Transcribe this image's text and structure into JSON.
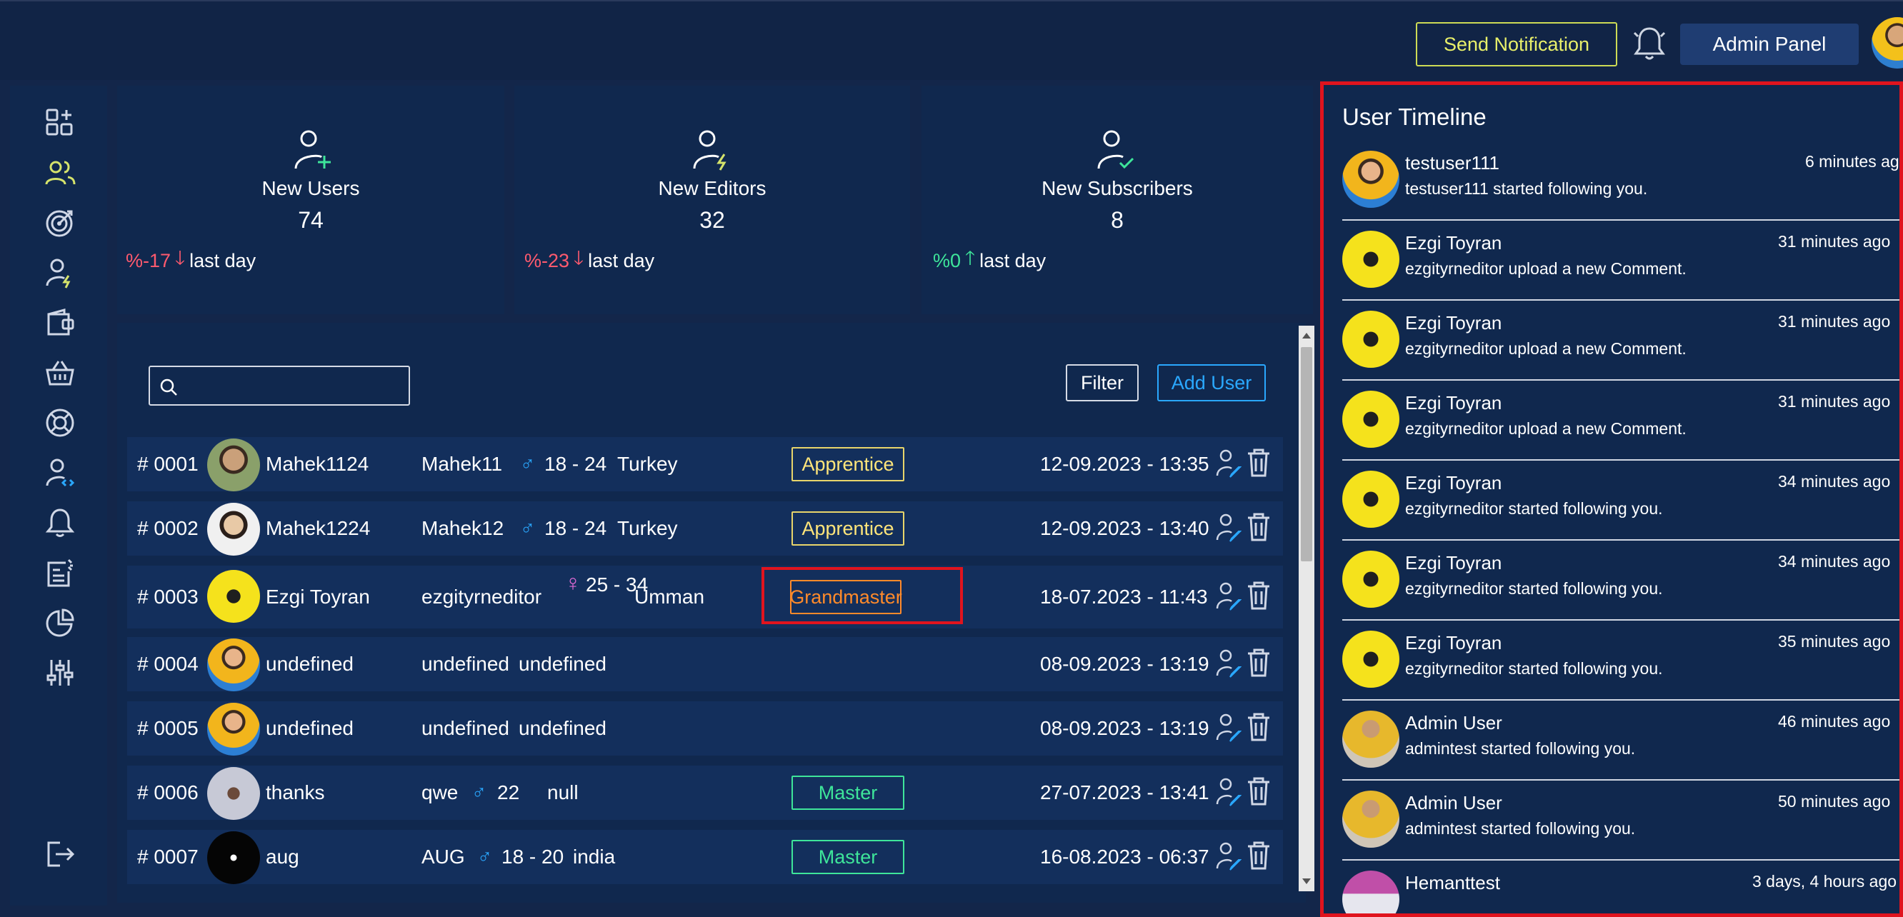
{
  "topbar": {
    "send_notification_label": "Send Notification",
    "admin_panel_label": "Admin Panel"
  },
  "sidebar": {
    "items": [
      "dashboard-icon",
      "users-icon",
      "target-icon",
      "editor-user-icon",
      "wallet-icon",
      "basket-icon",
      "lifebuoy-icon",
      "developer-user-icon",
      "bell-icon",
      "report-icon",
      "pie-chart-icon",
      "sliders-icon"
    ],
    "logout": "logout-icon"
  },
  "stats": [
    {
      "title": "New Users",
      "value": "74",
      "change": "%-17",
      "period": "last day",
      "trend": "down"
    },
    {
      "title": "New Editors",
      "value": "32",
      "change": "%-23",
      "period": "last day",
      "trend": "down"
    },
    {
      "title": "New Subscribers",
      "value": "8",
      "change": "%0",
      "period": "last day",
      "trend": "up"
    }
  ],
  "table": {
    "search_placeholder": "",
    "filter_label": "Filter",
    "add_user_label": "Add User",
    "rows": [
      {
        "id": "# 0001",
        "name": "Mahek1124",
        "username": "Mahek11",
        "gender": "♂",
        "age": "18 - 24",
        "country": "Turkey",
        "badge": "Apprentice",
        "date": "12-09.2023 - 13:35"
      },
      {
        "id": "# 0002",
        "name": "Mahek1224",
        "username": "Mahek12",
        "gender": "♂",
        "age": "18 - 24",
        "country": "Turkey",
        "badge": "Apprentice",
        "date": "12-09.2023 - 13:40"
      },
      {
        "id": "# 0003",
        "name": "Ezgi Toyran",
        "username": "ezgityrneditor",
        "gender": "♀",
        "age": "25 - 34",
        "country": "Umman",
        "badge": "Grandmaster",
        "date": "18-07.2023 - 11:43"
      },
      {
        "id": "# 0004",
        "name": "undefined",
        "username": "undefined",
        "gender": "",
        "age": "",
        "country": "undefined",
        "badge": "",
        "date": "08-09.2023 - 13:19"
      },
      {
        "id": "# 0005",
        "name": "undefined",
        "username": "undefined",
        "gender": "",
        "age": "",
        "country": "undefined",
        "badge": "",
        "date": "08-09.2023 - 13:19"
      },
      {
        "id": "# 0006",
        "name": "thanks",
        "username": "qwe",
        "gender": "♂",
        "age": "22",
        "country": "null",
        "badge": "Master",
        "date": "27-07.2023 - 13:41"
      },
      {
        "id": "# 0007",
        "name": "aug",
        "username": "AUG",
        "gender": "♂",
        "age": "18 - 20",
        "country": "india",
        "badge": "Master",
        "date": "16-08.2023 - 06:37"
      }
    ]
  },
  "timeline": {
    "title": "User Timeline",
    "items": [
      {
        "name": "testuser111",
        "text": "testuser111 started following you.",
        "time": "6 minutes ago"
      },
      {
        "name": "Ezgi Toyran",
        "text": "ezgityrneditor upload a new Comment.",
        "time": "31 minutes ago"
      },
      {
        "name": "Ezgi Toyran",
        "text": "ezgityrneditor upload a new Comment.",
        "time": "31 minutes ago"
      },
      {
        "name": "Ezgi Toyran",
        "text": "ezgityrneditor upload a new Comment.",
        "time": "31 minutes ago"
      },
      {
        "name": "Ezgi Toyran",
        "text": "ezgityrneditor started following you.",
        "time": "34 minutes ago"
      },
      {
        "name": "Ezgi Toyran",
        "text": "ezgityrneditor started following you.",
        "time": "34 minutes ago"
      },
      {
        "name": "Ezgi Toyran",
        "text": "ezgityrneditor started following you.",
        "time": "35 minutes ago"
      },
      {
        "name": "Admin User",
        "text": "admintest started following you.",
        "time": "46 minutes ago"
      },
      {
        "name": "Admin User",
        "text": "admintest started following you.",
        "time": "50 minutes ago"
      },
      {
        "name": "Hemanttest",
        "text": "",
        "time": "3 days, 4 hours ago"
      }
    ]
  },
  "colors": {
    "background": "#13264a",
    "panel": "#10284e",
    "accent_yellow": "#cddb55",
    "accent_blue": "#2aa8ff",
    "negative": "#ff5a6e",
    "positive": "#3ee59a",
    "highlight": "#e0141e"
  }
}
